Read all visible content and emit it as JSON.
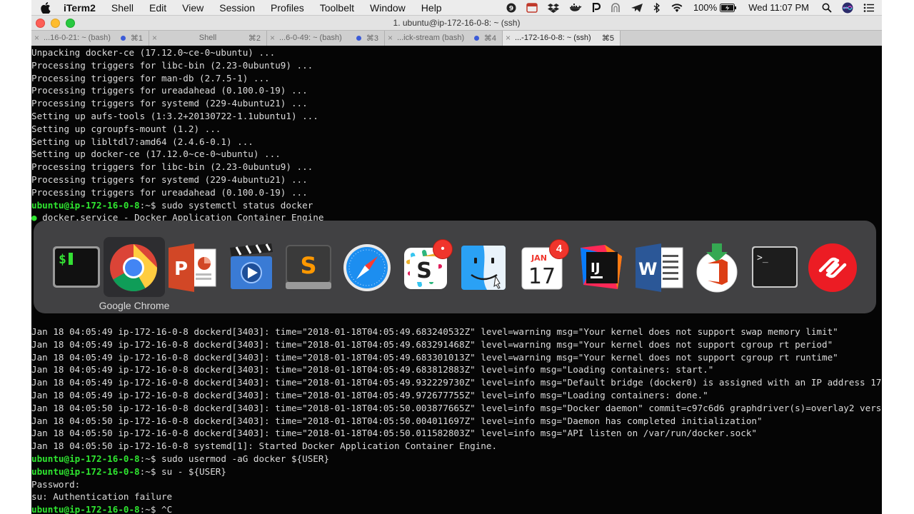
{
  "menubar": {
    "app_name": "iTerm2",
    "menus": [
      "Shell",
      "Edit",
      "View",
      "Session",
      "Profiles",
      "Toolbelt",
      "Window",
      "Help"
    ],
    "battery": "100%",
    "clock": "Wed 11:07 PM",
    "status_icons": [
      "alfred-icon",
      "fantastical-icon",
      "dropbox-icon",
      "docker-icon",
      "productive-icon",
      "unknown-arch-icon",
      "airmail-icon",
      "bluetooth-icon",
      "wifi-icon",
      "battery-icon",
      "spotlight-icon",
      "siri-icon",
      "notification-center-icon"
    ]
  },
  "window": {
    "title": "1. ubuntu@ip-172-16-0-8: ~ (ssh)",
    "tabs": [
      {
        "label": "...16-0-21: ~ (bash)",
        "key": "⌘1",
        "activity_dot": true,
        "active": false
      },
      {
        "label": "Shell",
        "key": "⌘2",
        "activity_dot": false,
        "active": false
      },
      {
        "label": "...6-0-49: ~ (bash)",
        "key": "⌘3",
        "activity_dot": true,
        "active": false
      },
      {
        "label": "...ick-stream (bash)",
        "key": "⌘4",
        "activity_dot": true,
        "active": false
      },
      {
        "label": "...-172-16-0-8: ~ (ssh)",
        "key": "⌘5",
        "activity_dot": false,
        "active": true
      }
    ]
  },
  "terminal": {
    "lines_top": [
      {
        "text": "Unpacking docker-ce (17.12.0~ce-0~ubuntu) ..."
      },
      {
        "text": "Processing triggers for libc-bin (2.23-0ubuntu9) ..."
      },
      {
        "text": "Processing triggers for man-db (2.7.5-1) ..."
      },
      {
        "text": "Processing triggers for ureadahead (0.100.0-19) ..."
      },
      {
        "text": "Processing triggers for systemd (229-4ubuntu21) ..."
      },
      {
        "text": "Setting up aufs-tools (1:3.2+20130722-1.1ubuntu1) ..."
      },
      {
        "text": "Setting up cgroupfs-mount (1.2) ..."
      },
      {
        "text": "Setting up libltdl7:amd64 (2.4.6-0.1) ..."
      },
      {
        "text": "Setting up docker-ce (17.12.0~ce-0~ubuntu) ..."
      },
      {
        "text": "Processing triggers for libc-bin (2.23-0ubuntu9) ..."
      },
      {
        "text": "Processing triggers for systemd (229-4ubuntu21) ..."
      },
      {
        "text": "Processing triggers for ureadahead (0.100.0-19) ..."
      },
      {
        "prompt": "ubuntu@ip-172-16-0-8",
        "text": ":~$ sudo systemctl status docker"
      },
      {
        "bullet": "●",
        "text": " docker.service - Docker Application Container Engine"
      }
    ],
    "lines_bottom": [
      {
        "text": "Jan 18 04:05:49 ip-172-16-0-8 dockerd[3403]: time=\"2018-01-18T04:05:49.683240532Z\" level=warning msg=\"Your kernel does not support swap memory limit\""
      },
      {
        "text": "Jan 18 04:05:49 ip-172-16-0-8 dockerd[3403]: time=\"2018-01-18T04:05:49.683291468Z\" level=warning msg=\"Your kernel does not support cgroup rt period\""
      },
      {
        "text": "Jan 18 04:05:49 ip-172-16-0-8 dockerd[3403]: time=\"2018-01-18T04:05:49.683301013Z\" level=warning msg=\"Your kernel does not support cgroup rt runtime\""
      },
      {
        "text": "Jan 18 04:05:49 ip-172-16-0-8 dockerd[3403]: time=\"2018-01-18T04:05:49.683812883Z\" level=info msg=\"Loading containers: start.\""
      },
      {
        "text": "Jan 18 04:05:49 ip-172-16-0-8 dockerd[3403]: time=\"2018-01-18T04:05:49.932229730Z\" level=info msg=\"Default bridge (docker0) is assigned with an IP address 172"
      },
      {
        "text": "Jan 18 04:05:49 ip-172-16-0-8 dockerd[3403]: time=\"2018-01-18T04:05:49.972677755Z\" level=info msg=\"Loading containers: done.\""
      },
      {
        "text": "Jan 18 04:05:50 ip-172-16-0-8 dockerd[3403]: time=\"2018-01-18T04:05:50.003877665Z\" level=info msg=\"Docker daemon\" commit=c97c6d6 graphdriver(s)=overlay2 versi"
      },
      {
        "text": "Jan 18 04:05:50 ip-172-16-0-8 dockerd[3403]: time=\"2018-01-18T04:05:50.004011697Z\" level=info msg=\"Daemon has completed initialization\""
      },
      {
        "text": "Jan 18 04:05:50 ip-172-16-0-8 dockerd[3403]: time=\"2018-01-18T04:05:50.011582803Z\" level=info msg=\"API listen on /var/run/docker.sock\""
      },
      {
        "text": "Jan 18 04:05:50 ip-172-16-0-8 systemd[1]: Started Docker Application Container Engine."
      },
      {
        "prompt": "ubuntu@ip-172-16-0-8",
        "text": ":~$ sudo usermod -aG docker ${USER}"
      },
      {
        "prompt": "ubuntu@ip-172-16-0-8",
        "text": ":~$ su - ${USER}"
      },
      {
        "text": "Password:"
      },
      {
        "text": "su: Authentication failure"
      },
      {
        "prompt": "ubuntu@ip-172-16-0-8",
        "text": ":~$ ^C"
      }
    ]
  },
  "switcher": {
    "selected_app": "Google Chrome",
    "apps": [
      {
        "name": "iTerm2",
        "icon": "iterm-icon"
      },
      {
        "name": "Google Chrome",
        "icon": "chrome-icon"
      },
      {
        "name": "Microsoft PowerPoint",
        "icon": "powerpoint-icon"
      },
      {
        "name": "Screenflow",
        "icon": "screenflow-icon"
      },
      {
        "name": "Sublime Text",
        "icon": "sublime-icon"
      },
      {
        "name": "Safari",
        "icon": "safari-icon"
      },
      {
        "name": "Slack",
        "icon": "slack-icon",
        "badge": "•"
      },
      {
        "name": "Finder",
        "icon": "finder-icon"
      },
      {
        "name": "Calendar",
        "icon": "calendar-icon",
        "badge": "4",
        "month": "JAN",
        "day": "17"
      },
      {
        "name": "IntelliJ IDEA",
        "icon": "intellij-icon",
        "glyph": "IJ"
      },
      {
        "name": "Microsoft Word",
        "icon": "word-icon",
        "glyph": "W"
      },
      {
        "name": "Office Installer",
        "icon": "office-installer-icon"
      },
      {
        "name": "Terminal",
        "icon": "terminal-icon",
        "glyph": ">_"
      },
      {
        "name": "Authy",
        "icon": "authy-icon"
      }
    ]
  }
}
